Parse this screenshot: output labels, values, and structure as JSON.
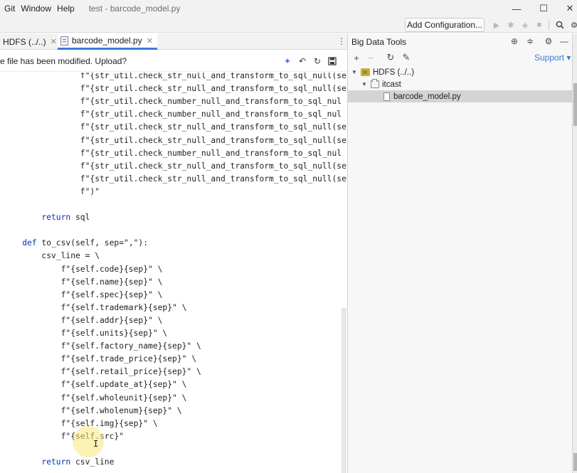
{
  "menu": {
    "items": [
      "Git",
      "Window",
      "Help"
    ],
    "window_title": "test - barcode_model.py"
  },
  "window_controls": {
    "minimize": "—",
    "maximize": "☐",
    "close": "✕"
  },
  "toolbar": {
    "add_configuration_label": "Add Configuration...",
    "icons": [
      "run-icon",
      "debug-icon",
      "coverage-icon",
      "stop-icon",
      "search-icon",
      "settings-icon"
    ]
  },
  "editor": {
    "tabs": [
      {
        "label": "HDFS (../..)",
        "active": false
      },
      {
        "label": "barcode_model.py",
        "active": true
      }
    ],
    "banner": {
      "message": "e file has been modified. Upload?"
    },
    "code_lines": [
      {
        "indent": 16,
        "text": "f\"{str_util.check_str_null_and_transform_to_sql_null(se"
      },
      {
        "indent": 16,
        "text": "f\"{str_util.check_str_null_and_transform_to_sql_null(se"
      },
      {
        "indent": 16,
        "text": "f\"{str_util.check_number_null_and_transform_to_sql_nul"
      },
      {
        "indent": 16,
        "text": "f\"{str_util.check_number_null_and_transform_to_sql_nul"
      },
      {
        "indent": 16,
        "text": "f\"{str_util.check_str_null_and_transform_to_sql_null(se"
      },
      {
        "indent": 16,
        "text": "f\"{str_util.check_str_null_and_transform_to_sql_null(se"
      },
      {
        "indent": 16,
        "text": "f\"{str_util.check_number_null_and_transform_to_sql_nul"
      },
      {
        "indent": 16,
        "text": "f\"{str_util.check_str_null_and_transform_to_sql_null(se"
      },
      {
        "indent": 16,
        "text": "f\"{str_util.check_str_null_and_transform_to_sql_null(se"
      },
      {
        "indent": 16,
        "text": "f\")\""
      },
      {
        "indent": 0,
        "text": ""
      },
      {
        "indent": 8,
        "text": "return sql"
      },
      {
        "indent": 0,
        "text": ""
      },
      {
        "indent": 4,
        "text": "def to_csv(self, sep=\",\"):"
      },
      {
        "indent": 8,
        "text": "csv_line = \\"
      },
      {
        "indent": 12,
        "text": "f\"{self.code}{sep}\" \\"
      },
      {
        "indent": 12,
        "text": "f\"{self.name}{sep}\" \\"
      },
      {
        "indent": 12,
        "text": "f\"{self.spec}{sep}\" \\"
      },
      {
        "indent": 12,
        "text": "f\"{self.trademark}{sep}\" \\"
      },
      {
        "indent": 12,
        "text": "f\"{self.addr}{sep}\" \\"
      },
      {
        "indent": 12,
        "text": "f\"{self.units}{sep}\" \\"
      },
      {
        "indent": 12,
        "text": "f\"{self.factory_name}{sep}\" \\"
      },
      {
        "indent": 12,
        "text": "f\"{self.trade_price}{sep}\" \\"
      },
      {
        "indent": 12,
        "text": "f\"{self.retail_price}{sep}\" \\"
      },
      {
        "indent": 12,
        "text": "f\"{self.update_at}{sep}\" \\"
      },
      {
        "indent": 12,
        "text": "f\"{self.wholeunit}{sep}\" \\"
      },
      {
        "indent": 12,
        "text": "f\"{self.wholenum}{sep}\" \\"
      },
      {
        "indent": 12,
        "text": "f\"{self.img}{sep}\" \\"
      },
      {
        "indent": 12,
        "text": "f\"{self.src}\""
      },
      {
        "indent": 0,
        "text": ""
      },
      {
        "indent": 8,
        "text": "return csv_line"
      }
    ]
  },
  "big_data_tools": {
    "title": "Big Data Tools",
    "support_label": "Support ▾",
    "tree": [
      {
        "label": "HDFS (../..)",
        "depth": 0,
        "kind": "hdfs",
        "expanded": true,
        "selected": false
      },
      {
        "label": "itcast",
        "depth": 1,
        "kind": "folder",
        "expanded": true,
        "selected": false
      },
      {
        "label": "barcode_model.py",
        "depth": 2,
        "kind": "file",
        "expanded": false,
        "selected": true
      }
    ]
  },
  "colors": {
    "accent": "#3d7bd9",
    "keyword": "#0033b3",
    "selection": "#d4d4d4",
    "caret_highlight": "#fae878"
  }
}
